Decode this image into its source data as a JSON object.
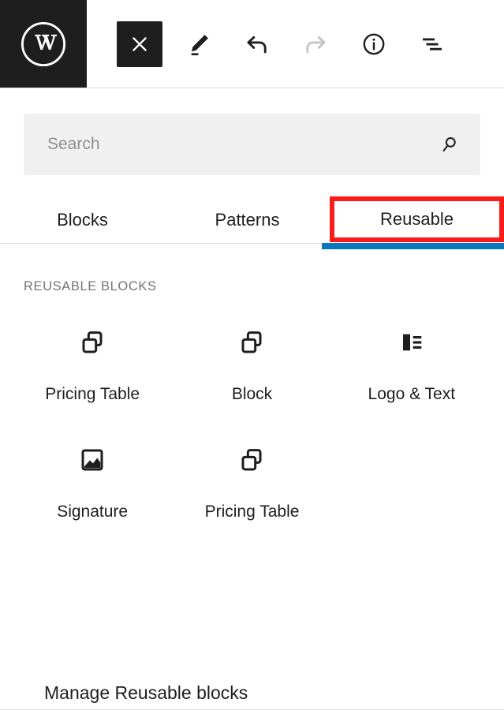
{
  "header": {
    "logo_icon": "wordpress-logo-icon",
    "toolbar": [
      {
        "name": "close-button",
        "icon": "close-x-icon",
        "state": "primary"
      },
      {
        "name": "edit-button",
        "icon": "pencil-icon",
        "state": "enabled"
      },
      {
        "name": "undo-button",
        "icon": "undo-arrow-icon",
        "state": "enabled"
      },
      {
        "name": "redo-button",
        "icon": "redo-arrow-icon",
        "state": "disabled"
      },
      {
        "name": "details-button",
        "icon": "info-circle-icon",
        "state": "enabled"
      },
      {
        "name": "list-view-button",
        "icon": "list-view-icon",
        "state": "enabled"
      }
    ]
  },
  "search": {
    "placeholder": "Search",
    "value": "",
    "icon": "magnifier-icon"
  },
  "tabs": [
    {
      "label": "Blocks",
      "active": false
    },
    {
      "label": "Patterns",
      "active": false
    },
    {
      "label": "Reusable",
      "active": true
    }
  ],
  "section": {
    "title": "REUSABLE BLOCKS"
  },
  "blocks": [
    {
      "label": "Pricing Table",
      "icon": "reusable-block-icon"
    },
    {
      "label": "Block",
      "icon": "reusable-block-icon"
    },
    {
      "label": "Logo & Text",
      "icon": "media-and-text-icon"
    },
    {
      "label": "Signature",
      "icon": "image-icon"
    },
    {
      "label": "Pricing Table",
      "icon": "reusable-block-icon"
    }
  ],
  "footer": {
    "manage_label": "Manage Reusable blocks"
  },
  "colors": {
    "highlight_box": "#fb1b1b",
    "active_tab_underline": "#0b77bd",
    "logo_background": "#1e1e1e",
    "search_background": "#f0f0f0",
    "muted_text": "#757575"
  }
}
